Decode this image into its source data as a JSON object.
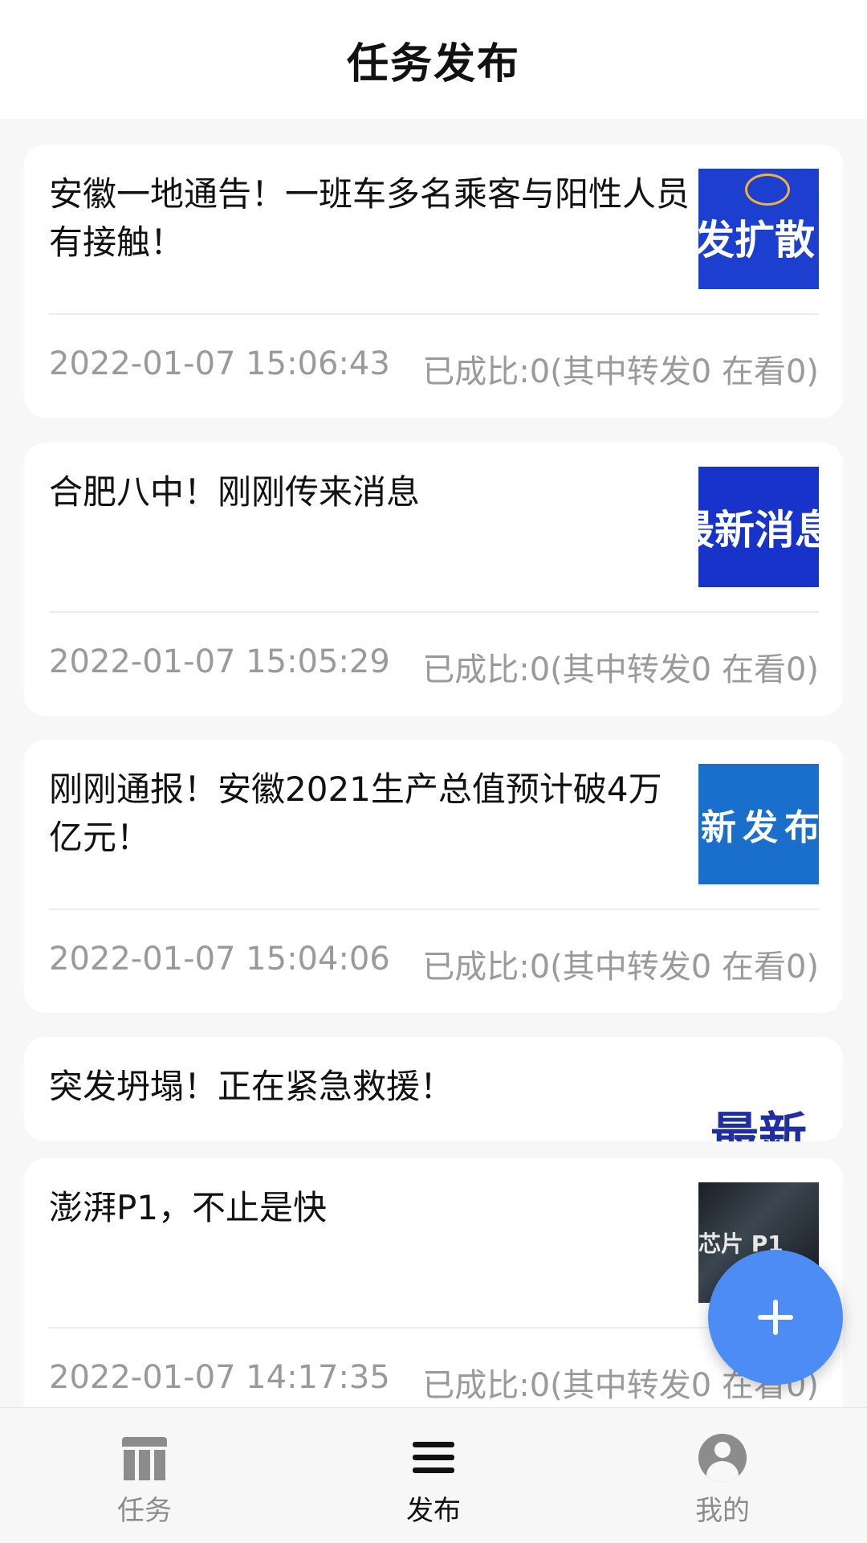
{
  "header": {
    "title": "任务发布"
  },
  "tasks": [
    {
      "title": "安徽一地通告！一班车多名乘客与阳性人员有接触！",
      "thumb_text": "转发扩散",
      "time": "2022-01-07 15:06:43",
      "stats": "已成比:0(其中转发0 在看0)"
    },
    {
      "title": "合肥八中！刚刚传来消息",
      "thumb_text": "最新消息",
      "time": "2022-01-07 15:05:29",
      "stats": "已成比:0(其中转发0 在看0)"
    },
    {
      "title": "刚刚通报！安徽2021生产总值预计破4万亿元！",
      "thumb_text": "最新发布",
      "time": "2022-01-07 15:04:06",
      "stats": "已成比:0(其中转发0 在看0)"
    },
    {
      "title": "突发坍塌！正在紧急救援！",
      "thumb_text": "最新"
    },
    {
      "title": "澎湃P1，不止是快",
      "thumb_text": "芯片 P1",
      "time": "2022-01-07 14:17:35",
      "stats": "已成比:0(其中转发0 在看0)"
    }
  ],
  "tabs": [
    {
      "label": "任务",
      "icon": "task-icon"
    },
    {
      "label": "发布",
      "icon": "publish-icon"
    },
    {
      "label": "我的",
      "icon": "profile-icon"
    }
  ],
  "colors": {
    "accent": "#4d8cf5",
    "inactive": "#8c8c8c",
    "active": "#111111"
  }
}
